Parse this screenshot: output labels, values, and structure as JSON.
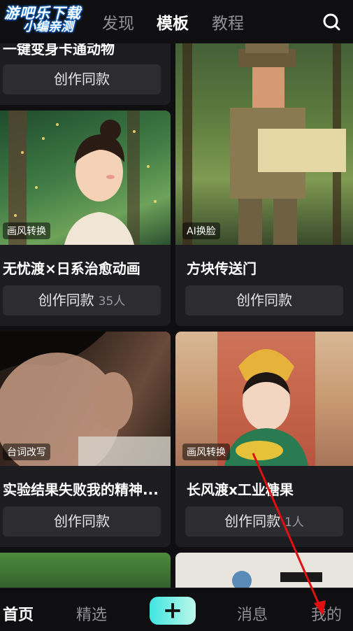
{
  "watermark": {
    "line1": "游吧乐下载",
    "line2": "小编亲测"
  },
  "top_tabs": [
    "发现",
    "模板",
    "教程"
  ],
  "cards": [
    {
      "title": "一键变身卡通动物",
      "button": "创作同款",
      "count": ""
    },
    {
      "title": "无忧渡×日系治愈动画",
      "badge": "画风转换",
      "button": "创作同款",
      "count": "35人"
    },
    {
      "title": "方块传送门",
      "badge": "AI换脸",
      "button": "创作同款",
      "count": ""
    },
    {
      "title": "实验结果失败我的精神...",
      "badge": "台词改写",
      "button": "创作同款",
      "count": ""
    },
    {
      "title": "长风渡x工业糖果",
      "badge": "画风转换",
      "button": "创作同款",
      "count": "1人"
    }
  ],
  "bottom_nav": {
    "home": "首页",
    "featured": "精选",
    "plus": "+",
    "messages": "消息",
    "me": "我的"
  },
  "colors": {
    "accent": "#3ee6e0",
    "annotation": "#e01010"
  }
}
